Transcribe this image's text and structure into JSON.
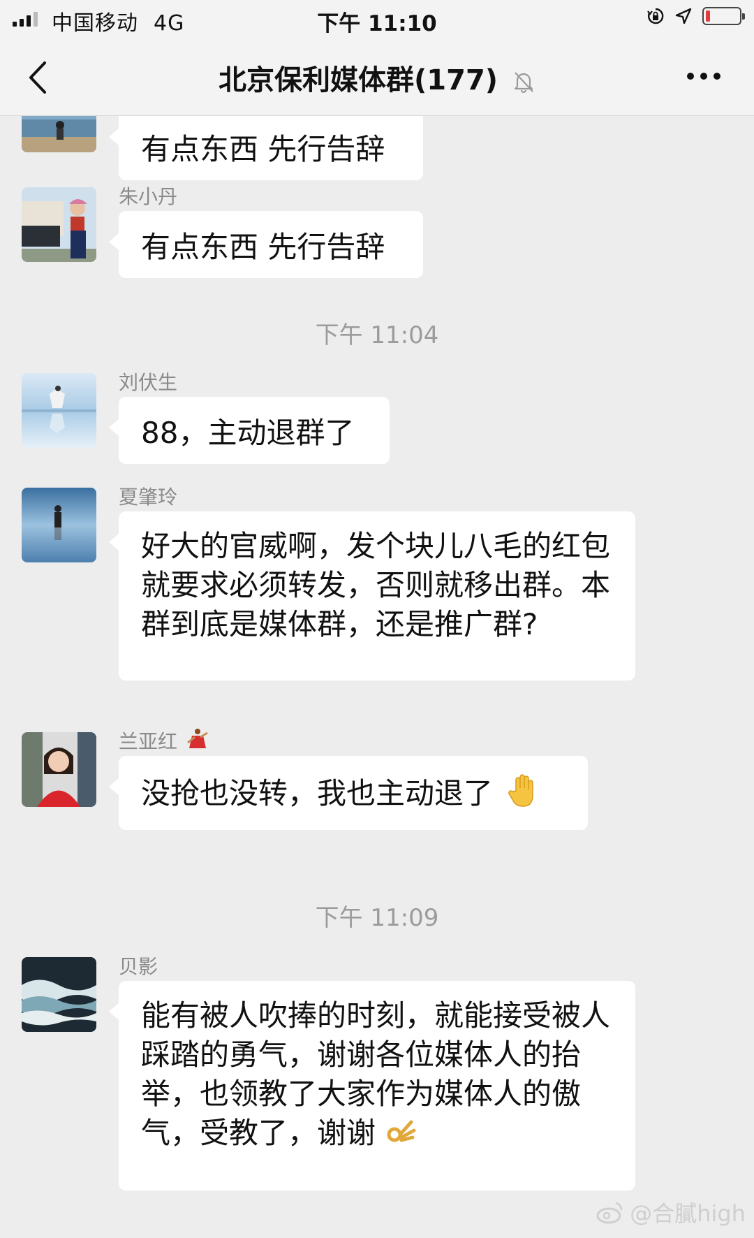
{
  "status_bar": {
    "carrier": "中国移动",
    "network": "4G",
    "time": "下午 11:10"
  },
  "nav": {
    "title": "北京保利媒体群(177)"
  },
  "messages": [
    {
      "sender": "",
      "text": "有点东西 先行告辞"
    },
    {
      "sender": "朱小丹",
      "text": "有点东西 先行告辞"
    },
    {
      "sender": "刘伏生",
      "text": "88，主动退群了"
    },
    {
      "sender": "夏肇玲",
      "text": "好大的官威啊，发个块儿八毛的红包就要求必须转发，否则就移出群。本群到底是媒体群，还是推广群?"
    },
    {
      "sender": "兰亚红",
      "text": "没抢也没转，我也主动退了"
    },
    {
      "sender": "贝影",
      "text": "能有被人吹捧的时刻，就能接受被人踩踏的勇气，谢谢各位媒体人的抬举，也领教了大家作为媒体人的傲气，受教了，谢谢"
    }
  ],
  "timestamps": [
    "下午 11:04",
    "下午 11:09"
  ],
  "watermark": "@合膩high",
  "colors": {
    "background": "#ededed",
    "bubble": "#ffffff",
    "battery_low": "#e43b3b"
  }
}
